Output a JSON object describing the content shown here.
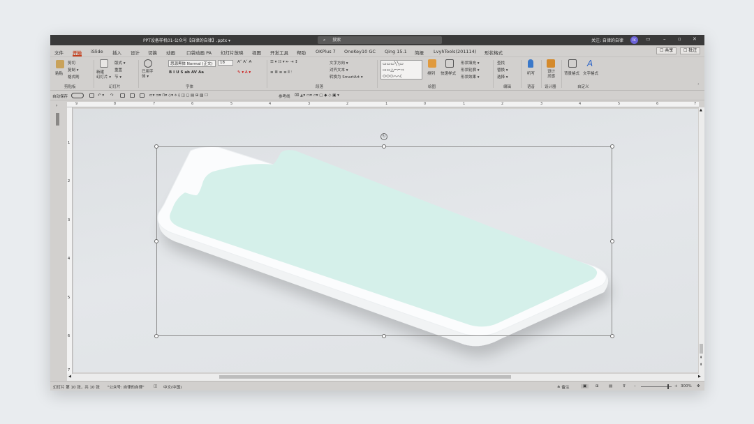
{
  "titlebar": {
    "doc": "PPT设备样机01-公众号【自律的自律】.pptx ▾",
    "search": "搜索",
    "user": "关注: 自律的自律",
    "avatar": "Ic"
  },
  "tabs": [
    "文件",
    "开始",
    "iSlide",
    "插入",
    "设计",
    "切换",
    "动画",
    "口袋动画 PA",
    "幻灯片放映",
    "视图",
    "开发工具",
    "帮助",
    "OKPlus 7",
    "OneKey10 GC",
    "Qing 15.1",
    "简报",
    "LvyhTools(201114)",
    "形状格式"
  ],
  "tab_buttons": {
    "share": "☐ 共享",
    "comment": "☐ 批注"
  },
  "ribbon": {
    "clipboard": {
      "paste": "粘贴",
      "cut": "剪切",
      "copy": "复制 ▾",
      "format": "格式刷",
      "label": "剪贴板"
    },
    "slides": {
      "new": "新建\n幻灯片 ▾",
      "layout": "版式 ▾",
      "reset": "重置",
      "section": "节 ▾",
      "label": "幻灯片"
    },
    "font": {
      "reuse": "已用字\n体 ▾",
      "name": "思源黑体 Normal (正文)",
      "size": "18",
      "label": "字体"
    },
    "paragraph": {
      "text_dir": "文字方向 ▾",
      "align_text": "对齐文本 ▾",
      "smartart": "转换为 SmartArt ▾",
      "label": "段落"
    },
    "drawing": {
      "arrange": "排列",
      "quick_styles": "快速样式",
      "fill": "形状填充 ▾",
      "outline": "形状轮廓 ▾",
      "effects": "形状效果 ▾",
      "label": "绘图"
    },
    "editing": {
      "find": "查找",
      "replace": "替换 ▾",
      "select": "选择 ▾",
      "label": "编辑"
    },
    "voice": {
      "dictate": "听写",
      "label": "语音"
    },
    "designer": {
      "ideas": "设计\n灵感",
      "label": "设计器"
    },
    "custom": {
      "bg": "背景格式",
      "text": "文字格式",
      "label": "自定义"
    }
  },
  "qat": {
    "autosave": "自动保存",
    "ref": "参考线"
  },
  "ruler": [
    "9",
    "8",
    "7",
    "6",
    "5",
    "4",
    "3",
    "2",
    "1",
    "0",
    "1",
    "2",
    "3",
    "4",
    "5",
    "6",
    "7"
  ],
  "vruler": [
    "1",
    "2",
    "3",
    "4",
    "5",
    "6",
    "7"
  ],
  "status": {
    "slide": "幻灯片 第 10 张，共 10 张",
    "theme": "\"公众号: 自律的自律\"",
    "lang": "中文(中国)",
    "notes": "≙ 备注",
    "zoom": "300%"
  },
  "colors": {
    "screen": "#d5f0ea",
    "body": "#fbfcfd",
    "accent": "#c43e1c"
  }
}
